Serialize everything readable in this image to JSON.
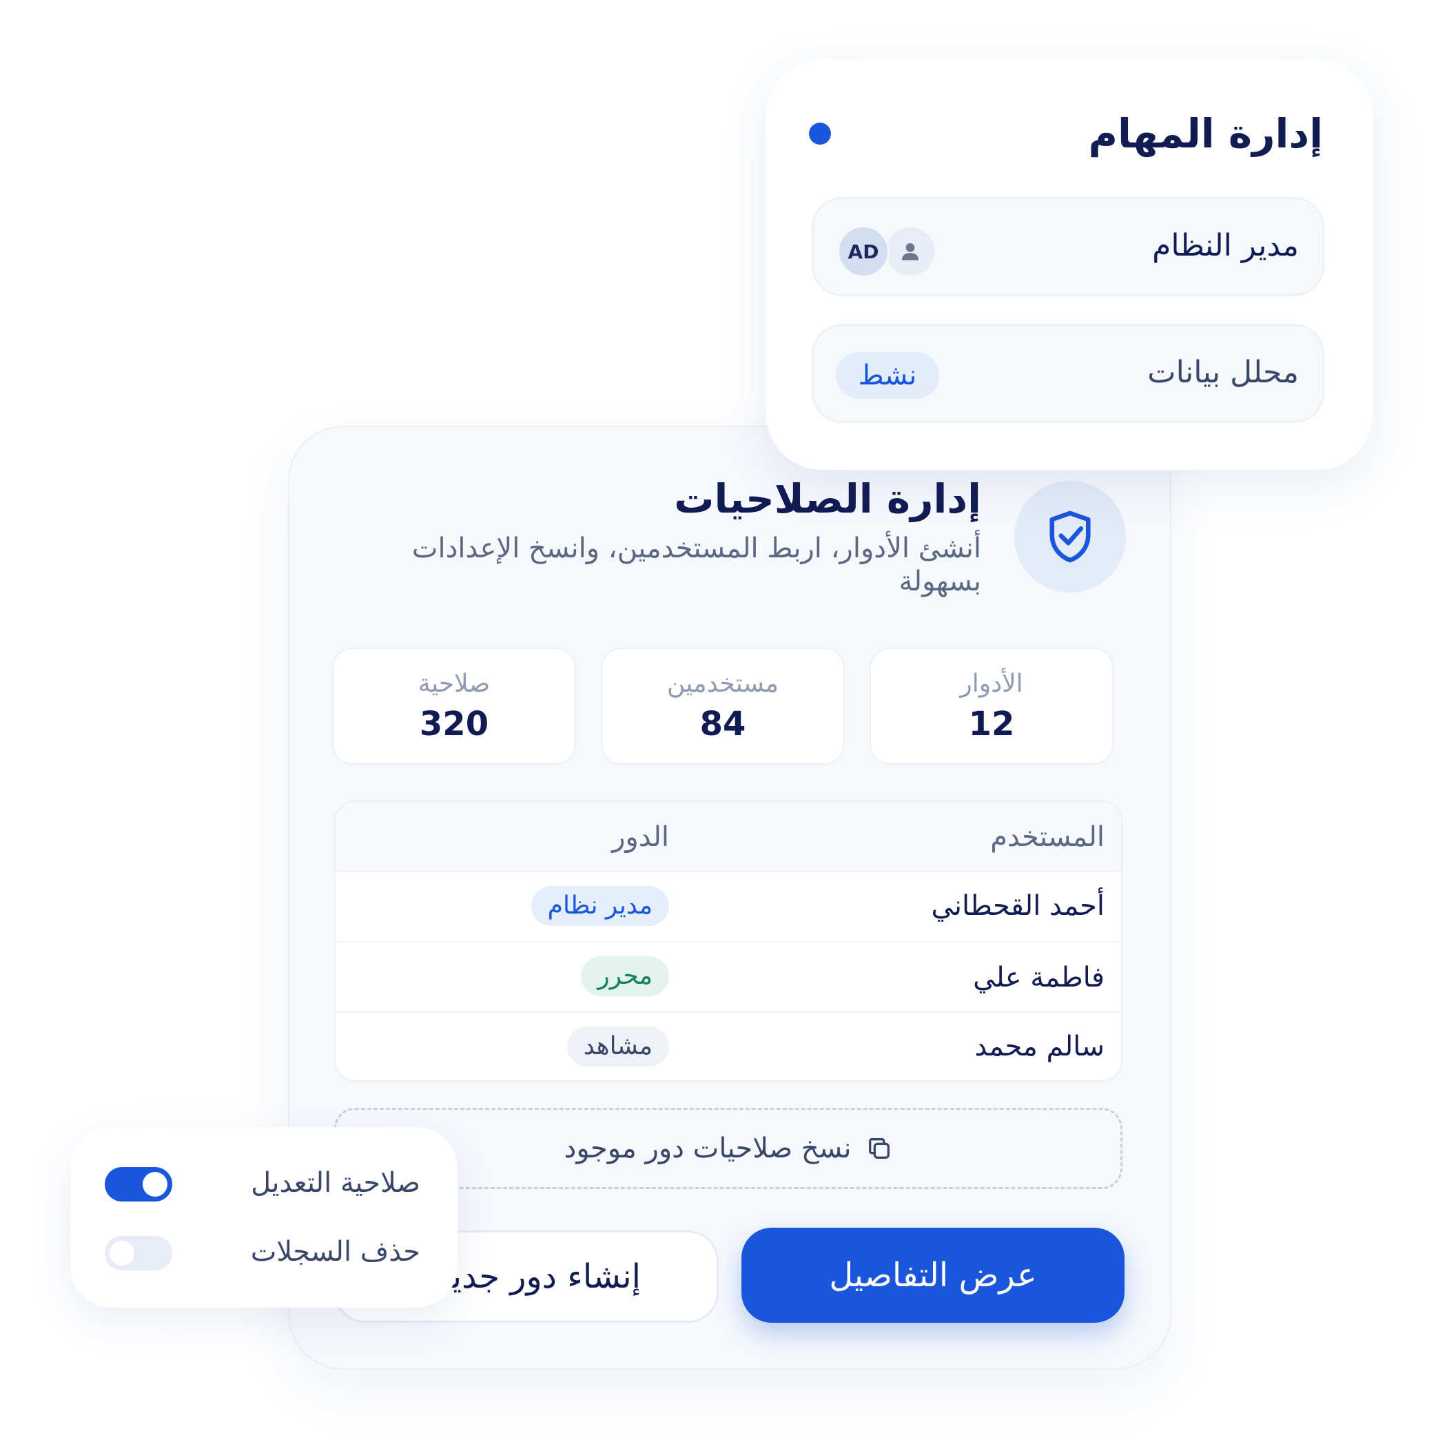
{
  "task_card": {
    "title": "إدارة المهام",
    "rows": [
      {
        "label": "مدير النظام",
        "avatar_text": "AD"
      },
      {
        "label": "محلل بيانات",
        "status": "نشط"
      }
    ]
  },
  "permissions": {
    "title": "إدارة الصلاحيات",
    "subtitle": "أنشئ الأدوار، اربط المستخدمين، وانسخ الإعدادات بسهولة",
    "stats": [
      {
        "label": "الأدوار",
        "value": "12"
      },
      {
        "label": "مستخدمين",
        "value": "84"
      },
      {
        "label": "صلاحية",
        "value": "320"
      }
    ],
    "table": {
      "headers": {
        "user": "المستخدم",
        "role": "الدور"
      },
      "rows": [
        {
          "user": "أحمد القحطاني",
          "role": "مدير نظام"
        },
        {
          "user": "فاطمة علي",
          "role": "محرر"
        },
        {
          "user": "سالم محمد",
          "role": "مشاهد"
        }
      ]
    },
    "copy_label": "نسخ صلاحيات دور موجود",
    "create_button": "إنشاء دور جديد",
    "details_button": "عرض التفاصيل"
  },
  "toggles": [
    {
      "label": "صلاحية التعديل",
      "on": true
    },
    {
      "label": "حذف السجلات",
      "on": false
    }
  ],
  "colors": {
    "primary": "#1a56db",
    "navy": "#111c52",
    "admin_badge_bg": "#e6eefb",
    "admin_badge_text": "#1a56db",
    "editor_badge_bg": "#e3f3ee",
    "editor_badge_text": "#15805a",
    "viewer_badge_bg": "#eef1f6",
    "viewer_badge_text": "#38476a"
  }
}
